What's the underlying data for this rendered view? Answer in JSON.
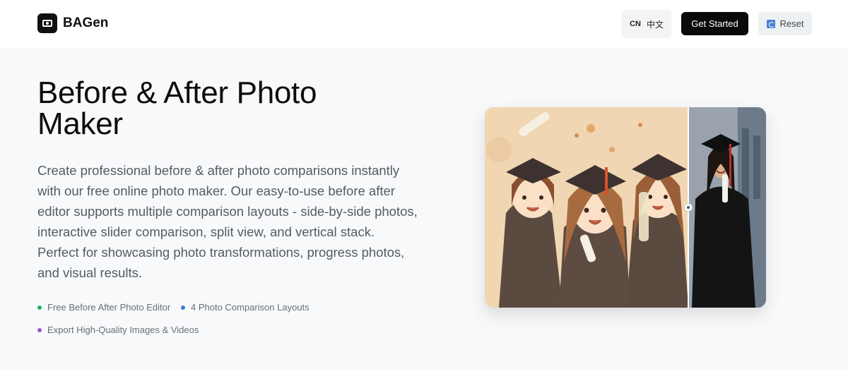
{
  "header": {
    "brand": "BAGen",
    "lang_code": "CN",
    "lang_label": "中文",
    "get_started": "Get Started",
    "reset": "Reset"
  },
  "hero": {
    "title": "Before & After Photo Maker",
    "description": "Create professional before & after photo comparisons instantly with our free online photo maker. Our easy-to-use before after editor supports multiple comparison layouts - side-by-side photos, interactive slider comparison, split view, and vertical stack. Perfect for showcasing photo transformations, progress photos, and visual results.",
    "features": [
      {
        "label": "Free Before After Photo Editor",
        "color": "#22b35e"
      },
      {
        "label": "4 Photo Comparison Layouts",
        "color": "#3b7ddd"
      },
      {
        "label": "Export High-Quality Images & Videos",
        "color": "#a44bd6"
      }
    ]
  },
  "preview": {
    "slider_position": 0.72,
    "icons": [
      "logo-icon",
      "reset-icon",
      "slider-handle-icon"
    ]
  },
  "colors": {
    "header_bg": "#ffffff",
    "page_bg": "#f7f9fb",
    "primary_button": "#0a0a0a",
    "reset_icon": "#4a7fd6"
  }
}
